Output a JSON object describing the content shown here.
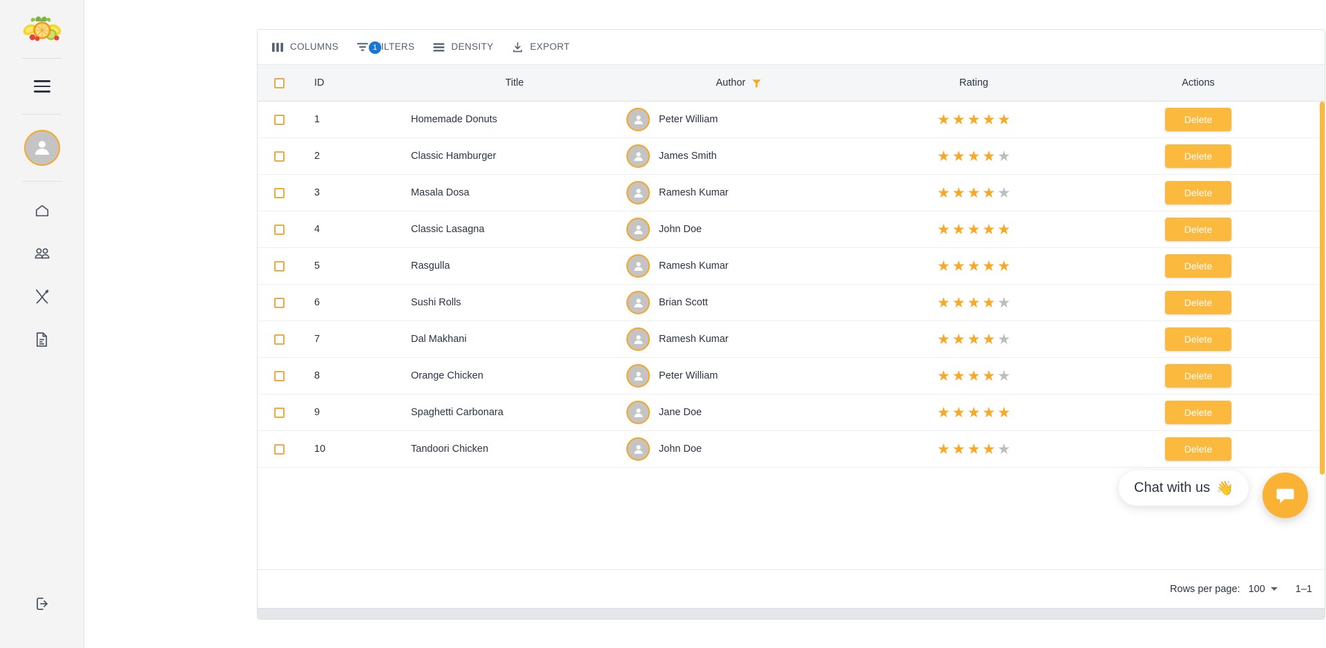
{
  "sidebar": {
    "logo": {
      "name": "fruit-logo",
      "alt": "Fresh fruit logo"
    },
    "menu_toggle": {
      "name": "hamburger-menu"
    },
    "avatar": {
      "name": "user-avatar"
    },
    "items": [
      {
        "label": "Home",
        "icon": "home-icon"
      },
      {
        "label": "Users",
        "icon": "users-icon"
      },
      {
        "label": "Restaurant",
        "icon": "cutlery-icon"
      },
      {
        "label": "Documents",
        "icon": "document-icon"
      }
    ],
    "logout": {
      "label": "Logout",
      "icon": "logout-icon"
    }
  },
  "toolbar": {
    "columns_label": "COLUMNS",
    "filters_label": "FILTERS",
    "filters_badge": "1",
    "density_label": "DENSITY",
    "export_label": "EXPORT"
  },
  "table": {
    "columns": [
      {
        "key": "id",
        "label": "ID"
      },
      {
        "key": "title",
        "label": "Title"
      },
      {
        "key": "author",
        "label": "Author",
        "filtered": true
      },
      {
        "key": "rating",
        "label": "Rating"
      },
      {
        "key": "actions",
        "label": "Actions"
      }
    ],
    "action_label": "Delete",
    "max_rating": 5,
    "rows": [
      {
        "id": "1",
        "title": "Homemade Donuts",
        "author": "Peter William",
        "rating": 5
      },
      {
        "id": "2",
        "title": "Classic Hamburger",
        "author": "James Smith",
        "rating": 4
      },
      {
        "id": "3",
        "title": "Masala Dosa",
        "author": "Ramesh Kumar",
        "rating": 4
      },
      {
        "id": "4",
        "title": "Classic Lasagna",
        "author": "John Doe",
        "rating": 5
      },
      {
        "id": "5",
        "title": "Rasgulla",
        "author": "Ramesh Kumar",
        "rating": 5
      },
      {
        "id": "6",
        "title": "Sushi Rolls",
        "author": "Brian Scott",
        "rating": 4
      },
      {
        "id": "7",
        "title": "Dal Makhani",
        "author": "Ramesh Kumar",
        "rating": 4
      },
      {
        "id": "8",
        "title": "Orange Chicken",
        "author": "Peter William",
        "rating": 4
      },
      {
        "id": "9",
        "title": "Spaghetti Carbonara",
        "author": "Jane Doe",
        "rating": 5
      },
      {
        "id": "10",
        "title": "Tandoori Chicken",
        "author": "John Doe",
        "rating": 4
      }
    ]
  },
  "footer": {
    "rows_per_page_label": "Rows per page:",
    "rows_per_page_value": "100",
    "range_label": "1–1"
  },
  "chat": {
    "bubble_text": "Chat with us",
    "bubble_emoji": "👋",
    "fab_icon": "chat-bubble-icon"
  },
  "colors": {
    "accent": "#fbb93e",
    "accent_star": "#f9a825",
    "badge_blue": "#1976d2",
    "header_bg": "#f4f6f8",
    "text": "#2b3445"
  }
}
